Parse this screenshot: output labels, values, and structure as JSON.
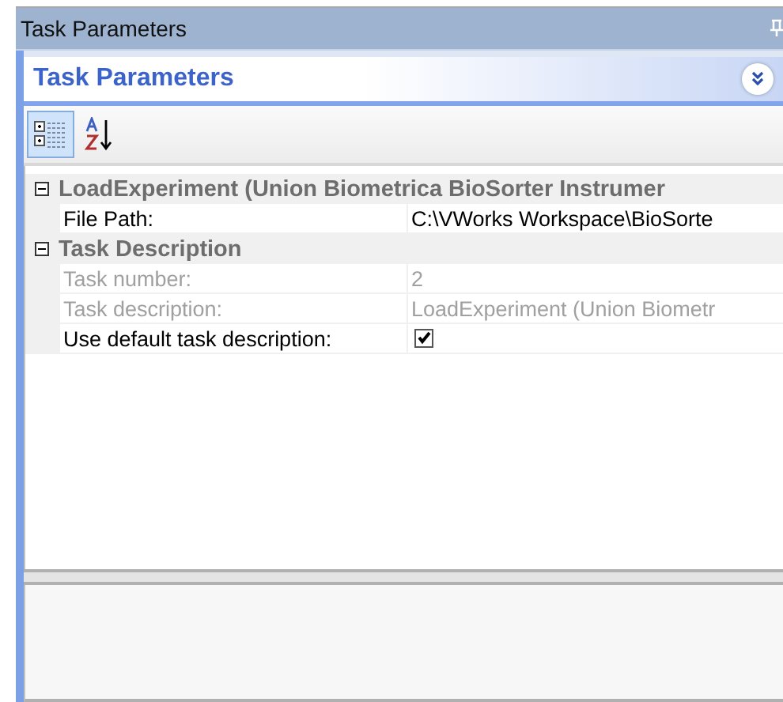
{
  "window": {
    "title": "Task Parameters"
  },
  "panel": {
    "title": "Task Parameters",
    "collapsed": false
  },
  "toolbar": [
    {
      "kind": "categorized",
      "selected": true
    },
    {
      "kind": "alphabetical",
      "selected": false
    }
  ],
  "categories": [
    {
      "name": "LoadExperiment (Union Biometrica BioSorter Instrumer",
      "expanded": true,
      "properties": [
        {
          "label": "File Path:",
          "kind": "text",
          "value": "C:\\VWorks Workspace\\BioSorte",
          "disabled": false
        }
      ]
    },
    {
      "name": "Task Description",
      "expanded": true,
      "properties": [
        {
          "label": "Task number:",
          "kind": "text",
          "value": "2",
          "disabled": true
        },
        {
          "label": "Task description:",
          "kind": "text",
          "value": "LoadExperiment (Union Biometr",
          "disabled": true
        },
        {
          "label": "Use default task description:",
          "kind": "checkbox",
          "checked": true,
          "disabled": false
        }
      ]
    }
  ]
}
